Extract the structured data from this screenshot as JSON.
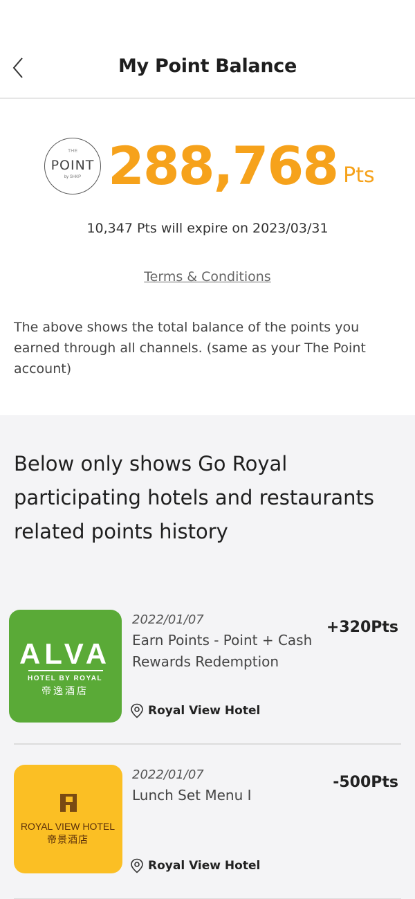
{
  "header": {
    "title": "My Point Balance",
    "back_icon": "chevron-left-icon"
  },
  "balance": {
    "logo_top": "THE",
    "logo_word": "POINT",
    "logo_by": "by SHKP",
    "value": "288,768",
    "unit": "Pts",
    "expire_text": "10,347 Pts will expire on 2023/03/31",
    "terms_label": "Terms & Conditions",
    "description": "The above shows the total balance of the points you earned through all channels. (same as your The Point account)",
    "accent_color": "#f6a21b"
  },
  "history": {
    "title": "Below only shows Go Royal participating hotels and restaurants related points history",
    "entries": [
      {
        "date": "2022/01/07",
        "description": "Earn Points - Point + Cash Rewards Redemption",
        "points": "+320Pts",
        "location": "Royal View Hotel",
        "logo": {
          "brand": "ALVA",
          "sub": "HOTEL BY ROYAL",
          "chinese": "帝逸酒店",
          "bg_color": "#5aaa37"
        }
      },
      {
        "date": "2022/01/07",
        "description": "Lunch Set Menu I",
        "points": "-500Pts",
        "location": "Royal View Hotel",
        "logo": {
          "brand": "ROYAL VIEW HOTEL",
          "chinese": "帝景酒店",
          "bg_color": "#fbbf24"
        }
      }
    ]
  }
}
